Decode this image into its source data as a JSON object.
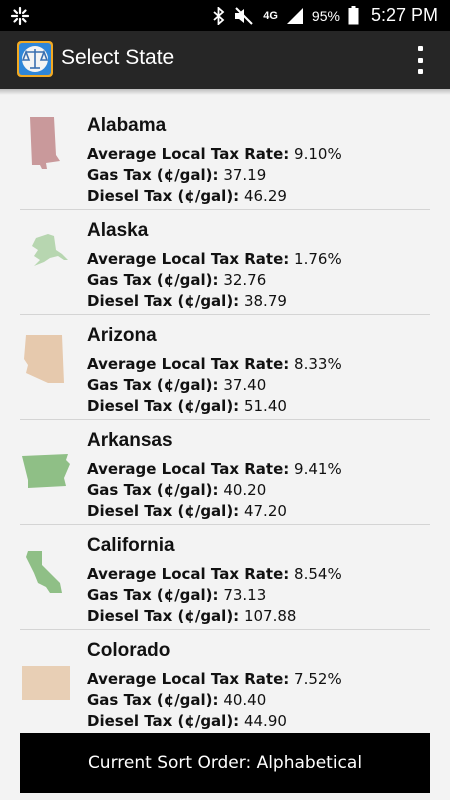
{
  "status_bar": {
    "network": "4G",
    "battery": "95%",
    "time": "5:27 PM",
    "icons": [
      "notification-icon",
      "bluetooth-icon",
      "mute-icon",
      "signal-icon",
      "battery-icon"
    ]
  },
  "action_bar": {
    "title": "Select State",
    "logo_icon": "scales-of-justice-icon",
    "overflow_icon": "overflow-menu-icon"
  },
  "labels": {
    "local": "Average Local Tax Rate:",
    "gas": "Gas Tax (¢/gal):",
    "diesel": "Diesel Tax (¢/gal):"
  },
  "states": [
    {
      "name": "Alabama",
      "local": "9.10%",
      "gas": "37.19",
      "diesel": "46.29",
      "map_color": "#c9999b"
    },
    {
      "name": "Alaska",
      "local": "1.76%",
      "gas": "32.76",
      "diesel": "38.79",
      "map_color": "#b7d6b0"
    },
    {
      "name": "Arizona",
      "local": "8.33%",
      "gas": "37.40",
      "diesel": "51.40",
      "map_color": "#e6c9ad"
    },
    {
      "name": "Arkansas",
      "local": "9.41%",
      "gas": "40.20",
      "diesel": "47.20",
      "map_color": "#8fbf86"
    },
    {
      "name": "California",
      "local": "8.54%",
      "gas": "73.13",
      "diesel": "107.88",
      "map_color": "#8fbf86"
    },
    {
      "name": "Colorado",
      "local": "7.52%",
      "gas": "40.40",
      "diesel": "44.90",
      "map_color": "#e8cfb5"
    }
  ],
  "sort_bar": {
    "text": "Current Sort Order: Alphabetical"
  }
}
